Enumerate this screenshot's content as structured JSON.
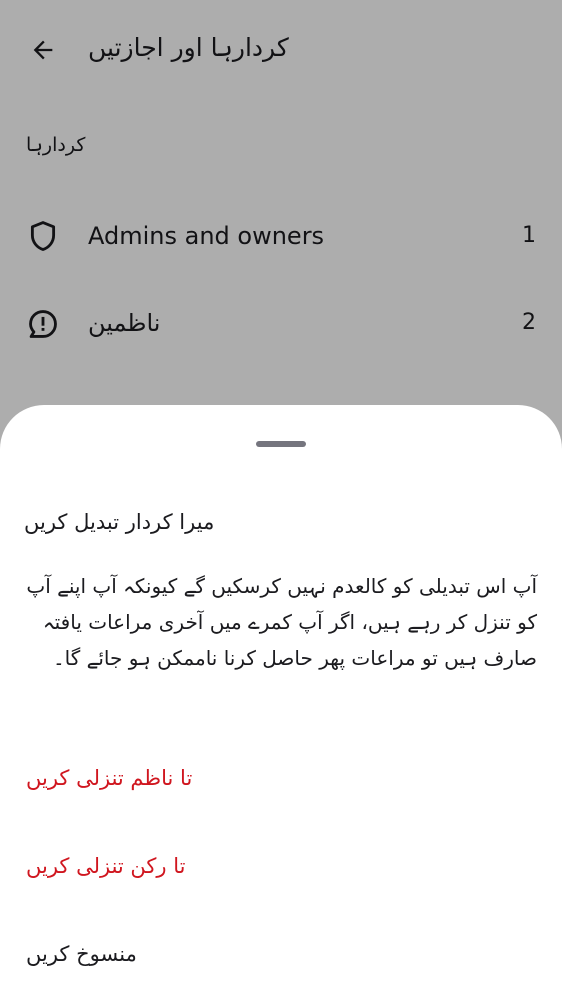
{
  "topbar": {
    "title": "کردارہا اور اجازتیں",
    "back_icon": "arrow-left-icon"
  },
  "roles_section": {
    "header": "کردارہا",
    "items": [
      {
        "label": "Admins and owners",
        "count": "1",
        "icon": "shield-icon"
      },
      {
        "label": "ناظمین",
        "count": "2",
        "icon": "exclamation-bubble-icon"
      }
    ]
  },
  "sheet": {
    "title": "میرا کردار تبدیل کریں",
    "body": "آپ اس تبدیلی کو کالعدم نہیں کرسکیں گے کیونکہ آپ اپنے آپ کو تنزل کر رہے ہیں، اگر آپ کمرے میں آخری مراعات یافتہ صارف ہیں تو مراعات پھر حاصل کرنا ناممکن ہو جائے گا۔",
    "actions": {
      "demote_to_moderator": "تا ناظم تنزلی کریں",
      "demote_to_member": "تا رکن تنزلی کریں",
      "cancel": "منسوخ کریں"
    }
  },
  "colors": {
    "danger": "#d0161f",
    "text": "#1b1b1f",
    "scrim": "rgba(0,0,0,0.32)",
    "handle": "#75757e"
  }
}
